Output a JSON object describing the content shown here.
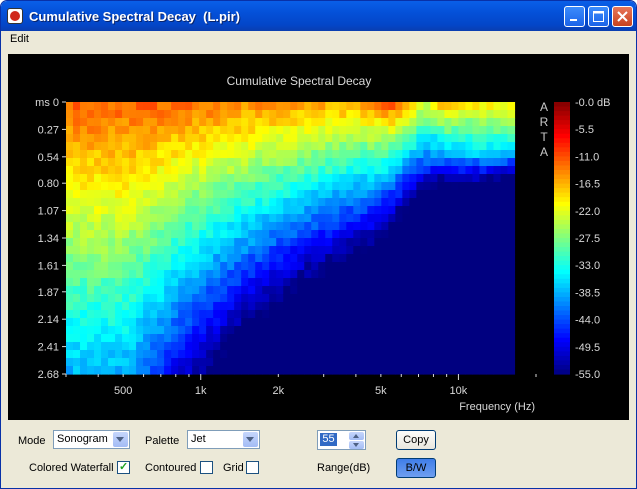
{
  "window": {
    "title": "Cumulative Spectral Decay  (L.pir)"
  },
  "menu": {
    "edit_label": "Edit"
  },
  "chart_data": {
    "type": "heatmap",
    "title": "Cumulative Spectral Decay",
    "xlabel": "Frequency (Hz)",
    "ylabel": "",
    "x_scale": "log",
    "xlim": [
      300,
      20000
    ],
    "x_ticks": [
      "500",
      "1k",
      "2k",
      "5k",
      "10k"
    ],
    "x_tick_values": [
      500,
      1000,
      2000,
      5000,
      10000
    ],
    "y_ticks": [
      "ms 0",
      "0.27",
      "0.54",
      "0.80",
      "1.07",
      "1.34",
      "1.61",
      "1.87",
      "2.14",
      "2.41",
      "2.68"
    ],
    "y_tick_values": [
      0,
      0.27,
      0.54,
      0.8,
      1.07,
      1.34,
      1.61,
      1.87,
      2.14,
      2.41,
      2.68
    ],
    "ylim": [
      0,
      2.68
    ],
    "colorbar_ticks": [
      "-0.0 dB",
      "-5.5",
      "-11.0",
      "-16.5",
      "-22.0",
      "-27.5",
      "-33.0",
      "-38.5",
      "-44.0",
      "-49.5",
      "-55.0"
    ],
    "zlim": [
      -55,
      0
    ],
    "watermark": "ARTA",
    "grid": false
  },
  "controls": {
    "mode_label": "Mode",
    "mode_value": "Sonogram",
    "palette_label": "Palette",
    "palette_value": "Jet",
    "range_value": "55",
    "range_label": "Range(dB)",
    "copy_label": "Copy",
    "bw_label": "B/W",
    "colored_waterfall_label": "Colored Waterfall",
    "colored_waterfall_checked": true,
    "contoured_label": "Contoured",
    "contoured_checked": false,
    "grid_label": "Grid",
    "grid_checked": false
  },
  "colors": {
    "titlebar": "#0450d8",
    "plot_bg": "#000000",
    "window_bg": "#ece9d8"
  }
}
